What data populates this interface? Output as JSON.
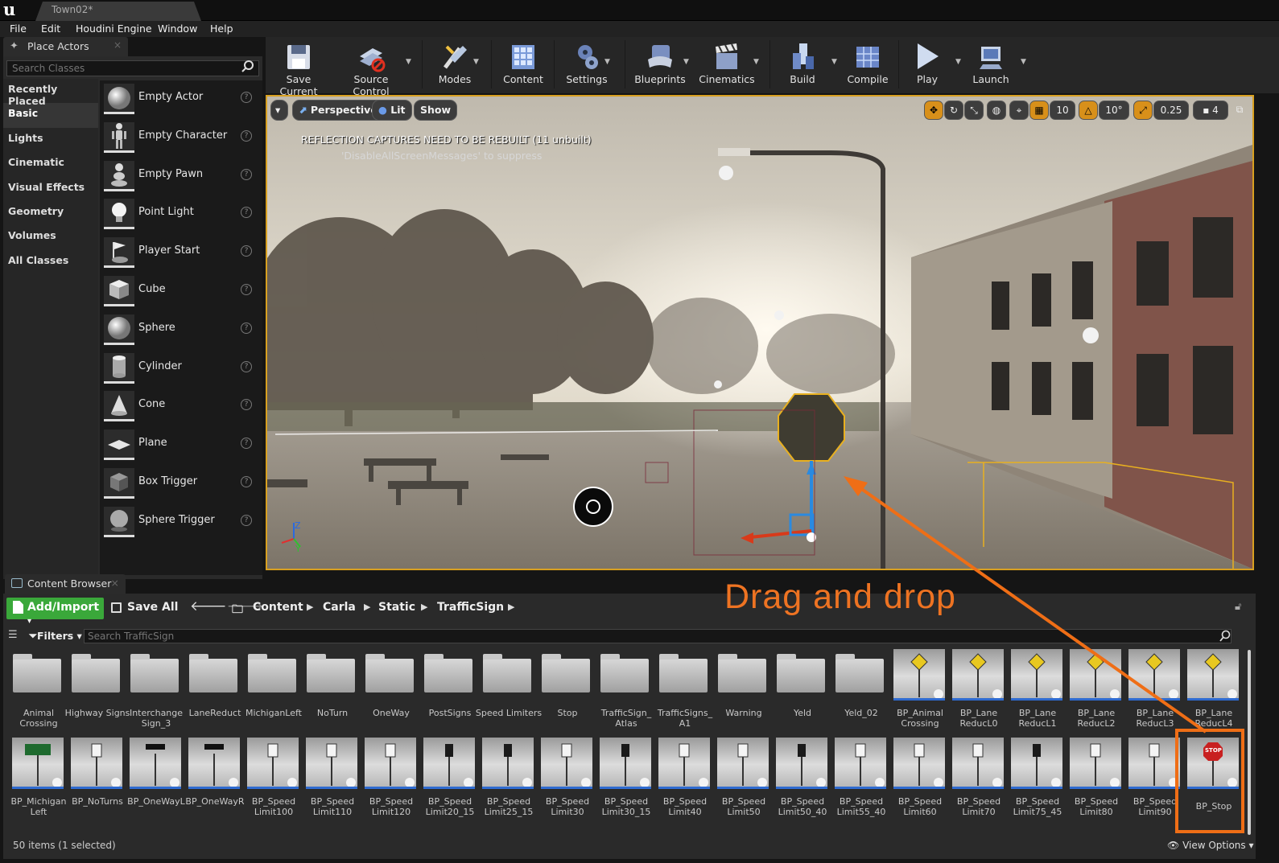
{
  "window": {
    "doc_tab": "Town02*",
    "logo": "u"
  },
  "menu": [
    "File",
    "Edit",
    "Houdini Engine",
    "Window",
    "Help"
  ],
  "place_actors": {
    "tab_title": "Place Actors",
    "search_placeholder": "Search Classes",
    "categories": [
      "Recently Placed",
      "Basic",
      "Lights",
      "Cinematic",
      "Visual Effects",
      "Geometry",
      "Volumes",
      "All Classes"
    ],
    "active_category": "Basic",
    "actors": [
      "Empty Actor",
      "Empty Character",
      "Empty Pawn",
      "Point Light",
      "Player Start",
      "Cube",
      "Sphere",
      "Cylinder",
      "Cone",
      "Plane",
      "Box Trigger",
      "Sphere Trigger"
    ]
  },
  "toolbar": [
    "Save Current",
    "Source Control",
    "Modes",
    "Content",
    "Settings",
    "Blueprints",
    "Cinematics",
    "Build",
    "Compile",
    "Play",
    "Launch"
  ],
  "viewport": {
    "perspective_label": "Perspective",
    "lit_label": "Lit",
    "show_label": "Show",
    "message_line1": "REFLECTION CAPTURES NEED TO BE REBUILT (11 unbuilt)",
    "message_line2": "'DisableAllScreenMessages' to suppress",
    "grid_snap": "10",
    "rotation_snap": "10°",
    "scale_snap": "0.25",
    "camera_speed": "4",
    "axis_z": "Z",
    "axis_y": "Y"
  },
  "content_browser": {
    "tab_title": "Content Browser",
    "add_import_label": "Add/Import",
    "save_all_label": "Save All",
    "breadcrumb": [
      "Content",
      "Carla",
      "Static",
      "TrafficSign"
    ],
    "filters_label": "Filters",
    "search_placeholder": "Search TrafficSign",
    "row1": [
      "Animal Crossing",
      "Highway Signs",
      "Interchange Sign_3",
      "LaneReduct",
      "MichiganLeft",
      "NoTurn",
      "OneWay",
      "PostSigns",
      "Speed Limiters",
      "Stop",
      "TrafficSign_ Atlas",
      "TrafficSigns_ A1",
      "Warning",
      "Yeld",
      "Yeld_02",
      "BP_Animal Crossing",
      "BP_Lane ReducL0",
      "BP_Lane ReducL1",
      "BP_Lane ReducL2",
      "BP_Lane ReducL3",
      "BP_Lane ReducL4"
    ],
    "row2": [
      "BP_Michigan Left",
      "BP_NoTurns",
      "BP_OneWayL",
      "BP_OneWayR",
      "BP_Speed Limit100",
      "BP_Speed Limit110",
      "BP_Speed Limit120",
      "BP_Speed Limit20_15",
      "BP_Speed Limit25_15",
      "BP_Speed Limit30",
      "BP_Speed Limit30_15",
      "BP_Speed Limit40",
      "BP_Speed Limit50",
      "BP_Speed Limit50_40",
      "BP_Speed Limit55_40",
      "BP_Speed Limit60",
      "BP_Speed Limit70",
      "BP_Speed Limit75_45",
      "BP_Speed Limit80",
      "BP_Speed Limit90",
      "BP_Stop"
    ],
    "stop_sign_text": "STOP",
    "status": "50 items (1 selected)",
    "view_options_label": "View Options"
  },
  "annotation": {
    "text": "Drag and drop",
    "color": "#ee7322"
  },
  "colors": {
    "selection_orange": "#ef6e16",
    "viewport_border": "#d8a020",
    "add_import_green": "#3aa83a"
  }
}
